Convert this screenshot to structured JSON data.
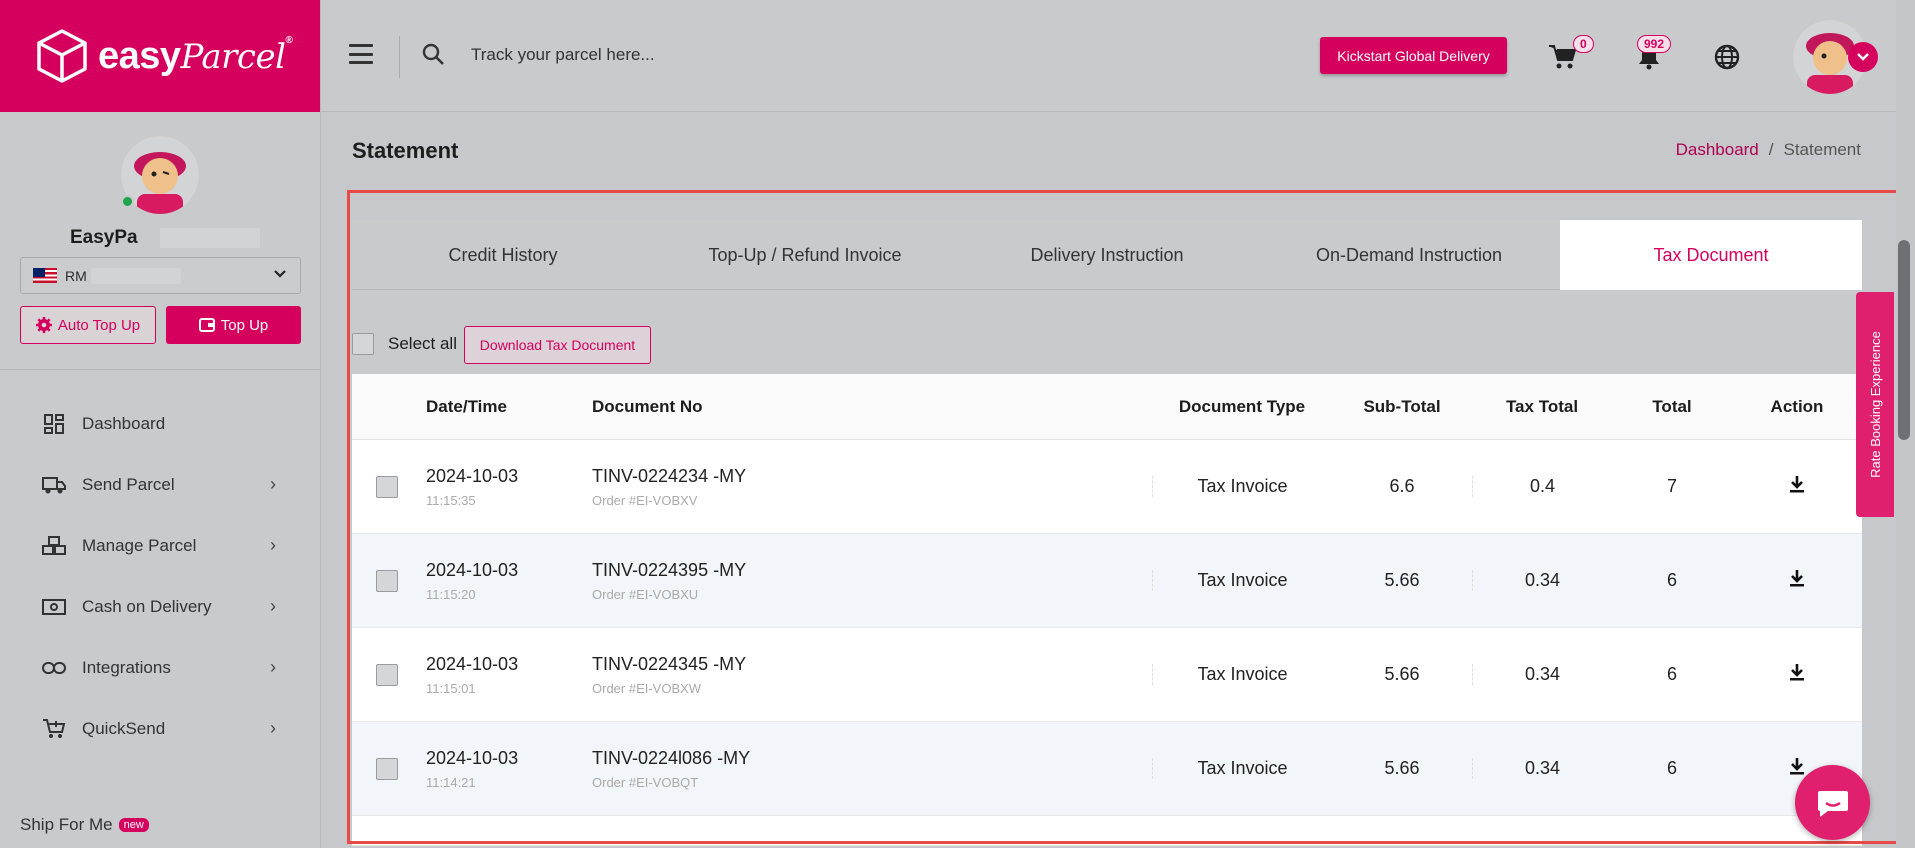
{
  "brand": {
    "name_bold": "easy",
    "name_script": "Parcel",
    "reg": "®",
    "accent": "#d5005e"
  },
  "sidebar": {
    "username": "EasyPa",
    "currency": "RM",
    "auto_topup_label": "Auto Top Up",
    "topup_label": "Top Up",
    "items": [
      {
        "label": "Dashboard",
        "icon": "dashboard-icon",
        "has_arrow": false
      },
      {
        "label": "Send Parcel",
        "icon": "truck-icon",
        "has_arrow": true
      },
      {
        "label": "Manage Parcel",
        "icon": "boxes-icon",
        "has_arrow": true
      },
      {
        "label": "Cash on Delivery",
        "icon": "cash-icon",
        "has_arrow": true
      },
      {
        "label": "Integrations",
        "icon": "link-icon",
        "has_arrow": true
      },
      {
        "label": "QuickSend",
        "icon": "cart-plus-icon",
        "has_arrow": true
      }
    ],
    "ship_for_me": "Ship For Me",
    "ship_for_me_badge": "new"
  },
  "topbar": {
    "search_placeholder": "Track your parcel here...",
    "global_btn": "Kickstart Global Delivery",
    "cart_count": "0",
    "notif_count": "992"
  },
  "page": {
    "title": "Statement",
    "breadcrumb": {
      "home": "Dashboard",
      "sep": "/",
      "current": "Statement"
    }
  },
  "tabs": [
    {
      "label": "Credit History",
      "active": false
    },
    {
      "label": "Top-Up / Refund Invoice",
      "active": false
    },
    {
      "label": "Delivery Instruction",
      "active": false
    },
    {
      "label": "On-Demand Instruction",
      "active": false
    },
    {
      "label": "Tax Document",
      "active": true
    }
  ],
  "toolbar": {
    "select_all": "Select all",
    "download": "Download Tax Document"
  },
  "table": {
    "headers": {
      "date": "Date/Time",
      "doc": "Document No",
      "type": "Document Type",
      "sub": "Sub-Total",
      "tax": "Tax Total",
      "total": "Total",
      "action": "Action"
    },
    "rows": [
      {
        "date": "2024-10-03",
        "time": "11:15:35",
        "doc_no": "TINV-0224234 -MY",
        "order": "Order #EI-VOBXV",
        "type": "Tax Invoice",
        "sub": "6.6",
        "tax": "0.4",
        "total": "7"
      },
      {
        "date": "2024-10-03",
        "time": "11:15:20",
        "doc_no": "TINV-0224395 -MY",
        "order": "Order #EI-VOBXU",
        "type": "Tax Invoice",
        "sub": "5.66",
        "tax": "0.34",
        "total": "6"
      },
      {
        "date": "2024-10-03",
        "time": "11:15:01",
        "doc_no": "TINV-0224345 -MY",
        "order": "Order #EI-VOBXW",
        "type": "Tax Invoice",
        "sub": "5.66",
        "tax": "0.34",
        "total": "6"
      },
      {
        "date": "2024-10-03",
        "time": "11:14:21",
        "doc_no": "TINV-0224l086 -MY",
        "order": "Order #EI-VOBQT",
        "type": "Tax Invoice",
        "sub": "5.66",
        "tax": "0.34",
        "total": "6"
      }
    ]
  },
  "side_tab": "Rate Booking Experience"
}
